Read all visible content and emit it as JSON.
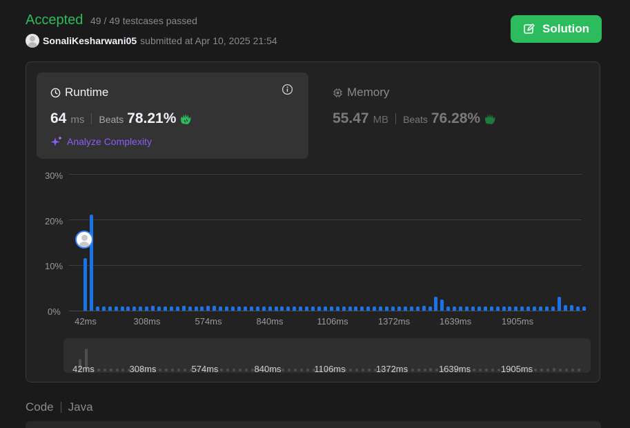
{
  "header": {
    "status": "Accepted",
    "testcases": "49 / 49 testcases passed",
    "username": "SonaliKesharwani05",
    "submitted_text": "submitted at Apr 10, 2025 21:54",
    "solution_button": "Solution"
  },
  "runtime": {
    "label": "Runtime",
    "value": "64",
    "unit": "ms",
    "beats_label": "Beats",
    "beats_pct": "78.21%",
    "analyze_label": "Analyze Complexity"
  },
  "memory": {
    "label": "Memory",
    "value": "55.47",
    "unit": "MB",
    "beats_label": "Beats",
    "beats_pct": "76.28%"
  },
  "code": {
    "label": "Code",
    "language": "Java"
  },
  "colors": {
    "accent_green": "#2cbb5d",
    "bar_blue": "#1a73e8",
    "analyze_purple": "#8b5cf6",
    "marker_ring": "#3b82f6"
  },
  "chart_data": {
    "type": "bar",
    "y_ticks": [
      "30%",
      "20%",
      "10%",
      "0%"
    ],
    "ylim": [
      0,
      30
    ],
    "x_tick_labels": [
      "42ms",
      "308ms",
      "574ms",
      "840ms",
      "1106ms",
      "1372ms",
      "1639ms",
      "1905ms"
    ],
    "mini_tick_labels": [
      "42ms",
      "308ms",
      "574ms",
      "840ms",
      "1106ms",
      "1372ms",
      "1639ms",
      "1905ms"
    ],
    "values": [
      11.5,
      21.0,
      0.9,
      0.9,
      0.9,
      0.9,
      0.9,
      0.9,
      0.9,
      0.9,
      0.9,
      1.1,
      0.9,
      0.9,
      0.9,
      0.9,
      1.0,
      0.9,
      0.9,
      0.9,
      1.1,
      1.1,
      0.9,
      0.9,
      0.9,
      0.9,
      0.9,
      0.9,
      0.9,
      0.9,
      0.9,
      0.9,
      0.9,
      0.9,
      0.9,
      0.9,
      0.9,
      0.9,
      0.9,
      0.9,
      0.9,
      0.9,
      0.9,
      0.9,
      0.9,
      0.9,
      0.9,
      0.9,
      0.9,
      0.9,
      0.9,
      0.9,
      0.9,
      0.9,
      0.9,
      1.0,
      0.9,
      3.0,
      2.5,
      0.9,
      0.9,
      0.9,
      0.9,
      0.9,
      0.9,
      0.9,
      0.9,
      0.9,
      0.9,
      0.9,
      0.9,
      0.9,
      0.9,
      0.9,
      0.9,
      0.9,
      0.9,
      3.0,
      1.2,
      1.2,
      0.9,
      0.9
    ],
    "highlight_index": 1
  }
}
